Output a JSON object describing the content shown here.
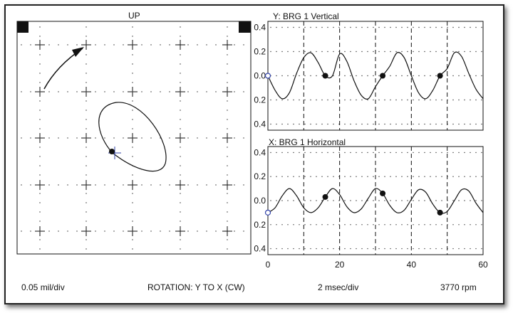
{
  "orbit": {
    "title": "UP"
  },
  "vertical": {
    "title": "Y: BRG 1 Vertical",
    "y_tick_labels": [
      "0.4",
      "0.2",
      "0.0",
      "0.2",
      "0.4"
    ]
  },
  "horizontal": {
    "title": "X: BRG 1 Horizontal",
    "y_tick_labels": [
      "0.4",
      "0.2",
      "0.0",
      "0.2",
      "0.4"
    ],
    "x_tick_labels": [
      "0",
      "20",
      "40",
      "60"
    ]
  },
  "footer": {
    "scale": "0.05 mil/div",
    "rotation": "ROTATION: Y TO X (CW)",
    "timebase": "2 msec/div",
    "speed": "3770 rpm"
  },
  "chart_data": [
    {
      "type": "line",
      "title": "Y: BRG 1 Vertical",
      "x": [
        0,
        2,
        4,
        6,
        8,
        10,
        12,
        14,
        16,
        18,
        20,
        22,
        24,
        26,
        28,
        30,
        32,
        34,
        36,
        38,
        40,
        42,
        44,
        46,
        48,
        50,
        52,
        54,
        56,
        58,
        60
      ],
      "series": [
        {
          "values": [
            0.0,
            -0.12,
            -0.19,
            -0.14,
            0.02,
            0.15,
            0.19,
            0.11,
            0.0,
            0.0,
            0.18,
            0.12,
            -0.04,
            -0.16,
            -0.19,
            -0.09,
            0.0,
            0.08,
            0.19,
            0.15,
            0.0,
            -0.14,
            -0.19,
            -0.12,
            0.0,
            0.06,
            0.19,
            0.16,
            0.02,
            -0.11,
            -0.19
          ]
        }
      ],
      "keyphasor_x": [
        0,
        16,
        32,
        48
      ],
      "ylim": [
        -0.45,
        0.45
      ],
      "xlim": [
        0,
        60
      ]
    },
    {
      "type": "line",
      "title": "X: BRG 1 Horizontal",
      "x": [
        0,
        2,
        4,
        6,
        8,
        10,
        12,
        14,
        16,
        18,
        20,
        22,
        24,
        26,
        28,
        30,
        32,
        34,
        36,
        38,
        40,
        42,
        44,
        46,
        48,
        50,
        52,
        54,
        56,
        58,
        60
      ],
      "series": [
        {
          "values": [
            -0.1,
            -0.06,
            0.04,
            0.1,
            0.04,
            -0.06,
            -0.1,
            -0.06,
            0.03,
            0.1,
            0.05,
            -0.05,
            -0.1,
            -0.07,
            0.02,
            0.1,
            0.06,
            -0.04,
            -0.1,
            -0.08,
            0.01,
            0.09,
            0.07,
            -0.03,
            -0.1,
            -0.09,
            0.0,
            0.09,
            0.08,
            -0.02,
            -0.1
          ]
        }
      ],
      "keyphasor_x": [
        0,
        16,
        32,
        48
      ],
      "ylim": [
        -0.45,
        0.45
      ],
      "xlim": [
        0,
        60
      ]
    }
  ]
}
